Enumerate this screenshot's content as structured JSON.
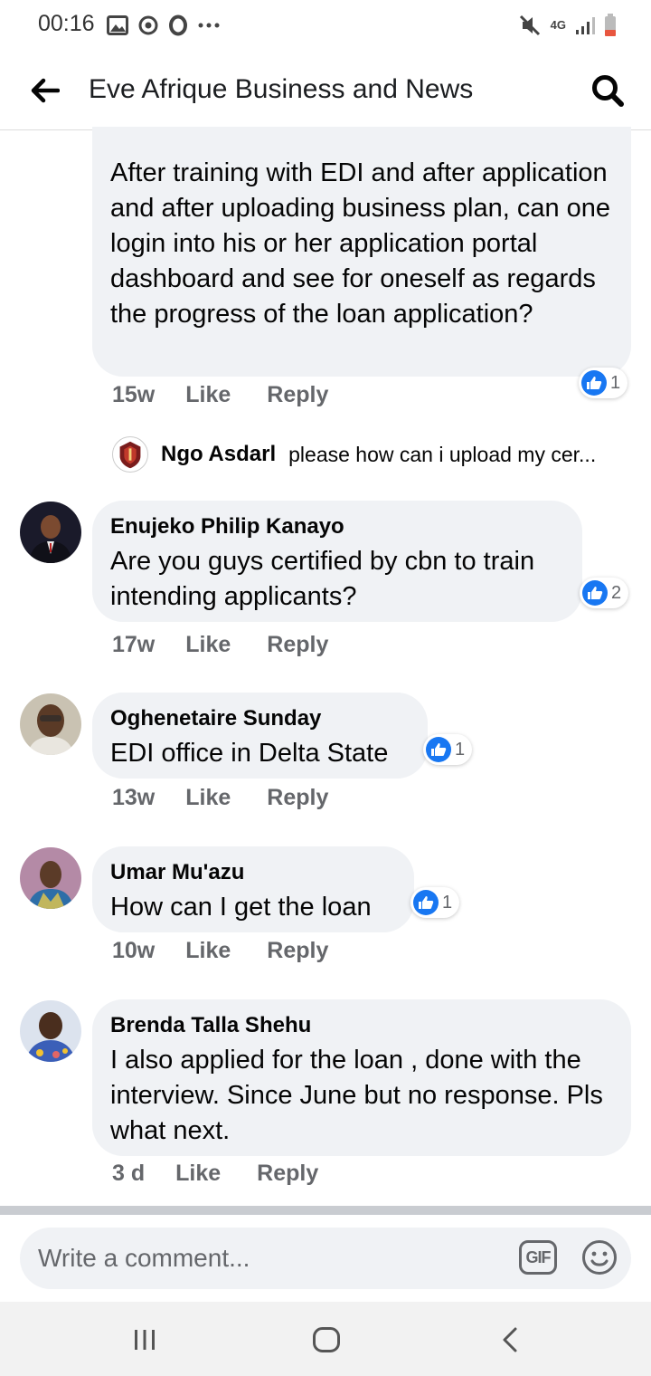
{
  "status_bar": {
    "time": "00:16",
    "network": "4G",
    "icons": [
      "gallery-icon",
      "sync-icon",
      "opera-icon",
      "more-icon",
      "mute-icon",
      "signal-icon",
      "battery-icon"
    ]
  },
  "header": {
    "title": "Eve Afrique Business and News",
    "back_icon": "arrow-left-icon",
    "search_icon": "search-icon"
  },
  "comments": [
    {
      "text": "After training with EDI and after application and after uploading business plan, can one login into his or her application portal dashboard and see for oneself as regards the progress of the loan application?",
      "time": "15w",
      "like_label": "Like",
      "reply_label": "Reply",
      "reactions": "1",
      "reply_preview": {
        "name": "Ngo Asdarl",
        "text": "please how can i upload my cer..."
      }
    },
    {
      "name": "Enujeko Philip Kanayo",
      "text": "Are you guys certified by cbn to train intending applicants?",
      "time": "17w",
      "like_label": "Like",
      "reply_label": "Reply",
      "reactions": "2"
    },
    {
      "name": "Oghenetaire Sunday",
      "text": "EDI office in Delta State",
      "time": "13w",
      "like_label": "Like",
      "reply_label": "Reply",
      "reactions": "1"
    },
    {
      "name": "Umar Mu'azu",
      "text": "How can I get the loan",
      "time": "10w",
      "like_label": "Like",
      "reply_label": "Reply",
      "reactions": "1"
    },
    {
      "name": "Brenda Talla Shehu",
      "text": "I also applied for the loan , done with the interview. Since June but no response. Pls what next.",
      "time": "3 d",
      "like_label": "Like",
      "reply_label": "Reply"
    }
  ],
  "composer": {
    "placeholder": "Write a comment...",
    "gif_label": "GIF"
  },
  "colors": {
    "bubble_bg": "#f0f2f5",
    "like_blue": "#1877f2",
    "meta_gray": "#65676b",
    "nav_bg": "#f2f2f2"
  }
}
